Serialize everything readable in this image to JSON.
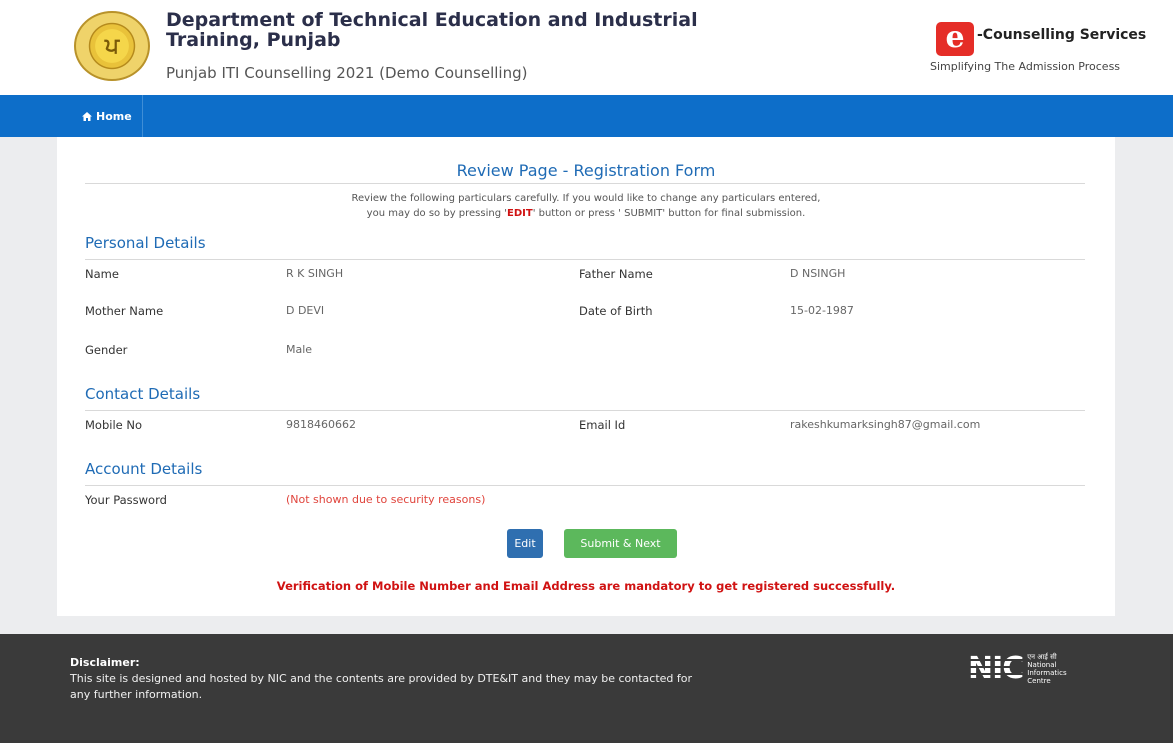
{
  "header": {
    "emblem_text": "ਪ",
    "title": "Department of Technical Education and Industrial Training, Punjab",
    "subtitle": "Punjab ITI Counselling 2021 (Demo Counselling)",
    "brand_logo": "e",
    "brand_name": "-Counselling Services",
    "brand_tagline": "Simplifying The Admission Process"
  },
  "nav": {
    "home_label": "Home",
    "home_icon": "home-icon"
  },
  "review": {
    "title": "Review Page - Registration Form",
    "instr_line1": "Review the following particulars carefully. If you would like to change any particulars entered,",
    "instr_pre": "you may do so by pressing '",
    "instr_edit": "EDIT",
    "instr_mid": "' button or press ' SUBMIT' button for final submission."
  },
  "personal": {
    "heading": "Personal Details",
    "name_label": "Name",
    "name_value": "R K SINGH",
    "father_label": "Father Name",
    "father_value": "D NSINGH",
    "mother_label": "Mother Name",
    "mother_value": "D DEVI",
    "dob_label": "Date of Birth",
    "dob_value": "15-02-1987",
    "gender_label": "Gender",
    "gender_value": "Male"
  },
  "contact": {
    "heading": "Contact Details",
    "mobile_label": "Mobile No",
    "mobile_value": "9818460662",
    "email_label": "Email Id",
    "email_value": "rakeshkumarksingh87@gmail.com"
  },
  "account": {
    "heading": "Account Details",
    "password_label": "Your Password",
    "password_value": "(Not shown due to security reasons)"
  },
  "actions": {
    "edit_label": "Edit",
    "submit_label": "Submit & Next"
  },
  "warning": "Verification of Mobile Number and Email Address are mandatory to get registered successfully.",
  "footer": {
    "disclaimer_title": "Disclaimer:",
    "disclaimer_text": "This site is designed and hosted by NIC and the contents are provided by DTE&IT and they may be contacted for any further information.",
    "nic_letters": "NIC",
    "nic_hindi": "एन आई सी",
    "nic_name": "National Informatics Centre"
  },
  "colors": {
    "nav": "#0d6ec9",
    "heading": "#1f6bb5",
    "alert": "#d01212",
    "edit": "#2f6fb0",
    "submit": "#5cb85c",
    "footer": "#3a3a3a"
  }
}
